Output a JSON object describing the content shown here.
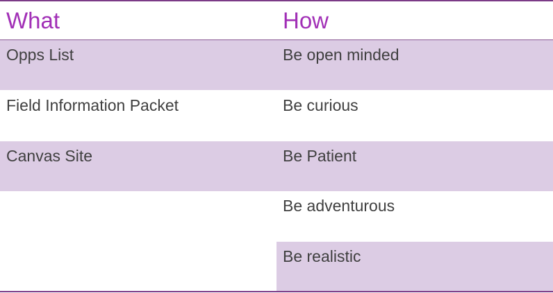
{
  "headers": {
    "what": "What",
    "how": "How"
  },
  "rows": [
    {
      "what": "Opps List",
      "how": "Be open minded"
    },
    {
      "what": "Field Information Packet",
      "how": "Be curious"
    },
    {
      "what": "Canvas Site",
      "how": "Be Patient"
    },
    {
      "what": "",
      "how": "Be adventurous"
    },
    {
      "what": "",
      "how": "Be realistic"
    }
  ],
  "colors": {
    "header_text": "#a12fb6",
    "row_shade": "#dccce4",
    "rule": "#7b3a86",
    "body_text": "#3f3f3f"
  }
}
